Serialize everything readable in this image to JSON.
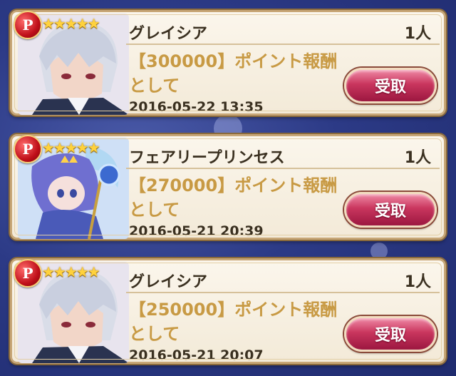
{
  "colors": {
    "background": "#2c3a86",
    "card": "#fbf6ec",
    "card_border": "#c7a676",
    "reward_text": "#c89a44",
    "button": "#c9365e"
  },
  "badge_label": "P",
  "stars": "★★★★★",
  "items": [
    {
      "name": "グレイシア",
      "count": "1人",
      "reward": "【300000】ポイント報酬",
      "note": "として",
      "date": "2016-05-22 13:35",
      "button": "受取",
      "portrait_icon": "silver-haired-boy-portrait"
    },
    {
      "name": "フェアリープリンセス",
      "count": "1人",
      "reward": "【270000】ポイント報酬",
      "note": "として",
      "date": "2016-05-21 20:39",
      "button": "受取",
      "portrait_icon": "fairy-princess-portrait"
    },
    {
      "name": "グレイシア",
      "count": "1人",
      "reward": "【250000】ポイント報酬",
      "note": "として",
      "date": "2016-05-21 20:07",
      "button": "受取",
      "portrait_icon": "silver-haired-boy-portrait"
    }
  ]
}
